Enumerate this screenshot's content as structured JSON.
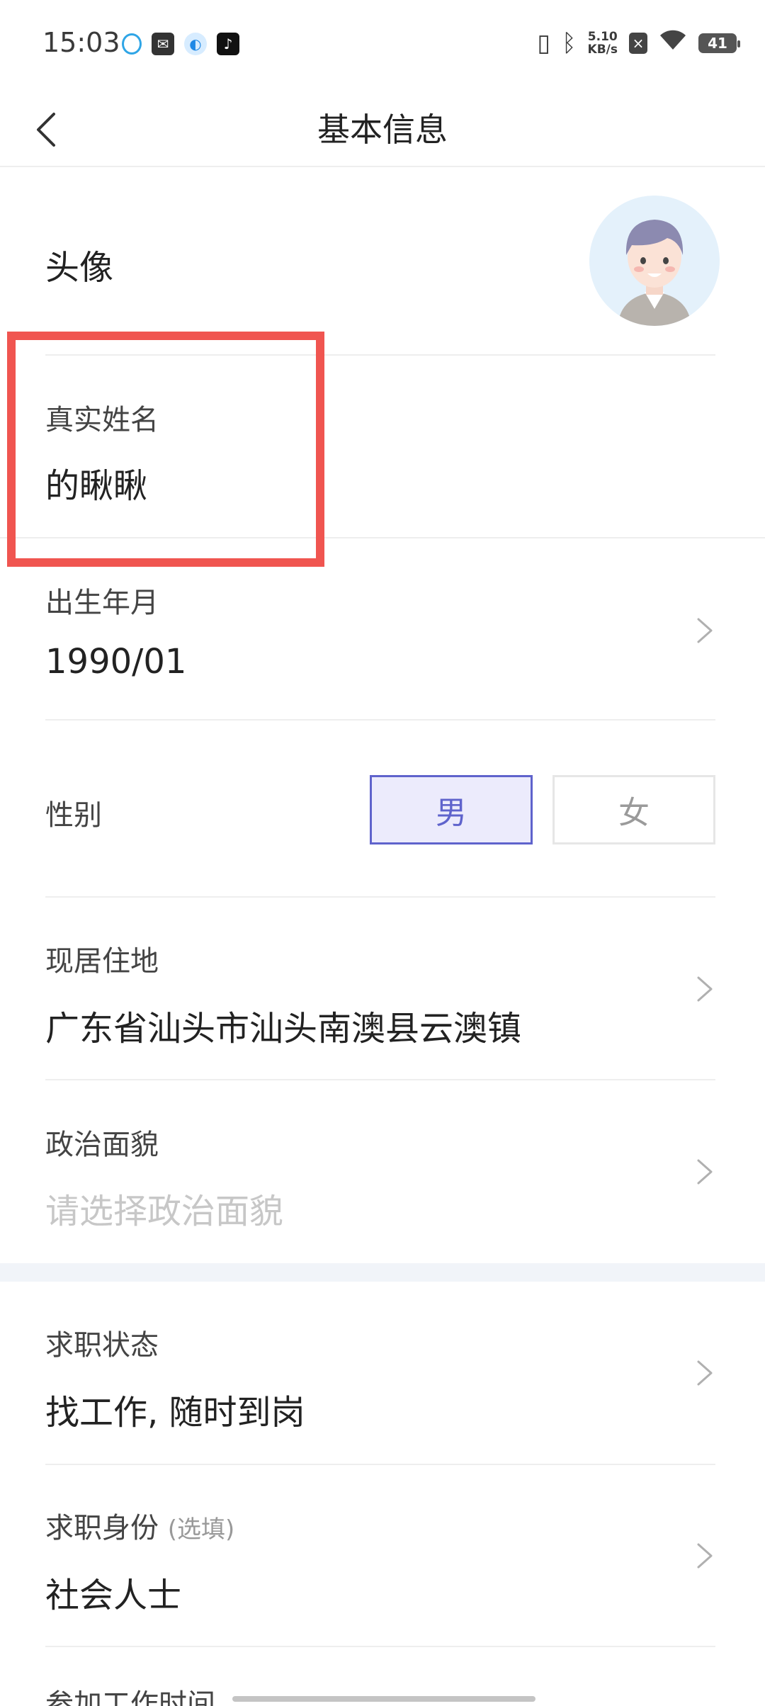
{
  "status_bar": {
    "time": "15:03",
    "net_speed_top": "5.10",
    "net_speed_bottom": "KB/s",
    "battery": "41"
  },
  "nav": {
    "title": "基本信息"
  },
  "avatar": {
    "label": "头像"
  },
  "name": {
    "label": "真实姓名",
    "value": "的瞅瞅"
  },
  "birth": {
    "label": "出生年月",
    "value": "1990/01"
  },
  "gender": {
    "label": "性别",
    "male": "男",
    "female": "女",
    "selected": "男"
  },
  "residence": {
    "label": "现居住地",
    "value": "广东省汕头市汕头南澳县云澳镇"
  },
  "political": {
    "label": "政治面貌",
    "placeholder": "请选择政治面貌"
  },
  "job_status": {
    "label": "求职状态",
    "value": "找工作, 随时到岗"
  },
  "job_identity": {
    "label": "求职身份",
    "optional": "(选填)",
    "value": "社会人士"
  },
  "work_start": {
    "label": "参加工作时间"
  },
  "colors": {
    "accent": "#5f63cc",
    "highlight": "#f05550"
  }
}
